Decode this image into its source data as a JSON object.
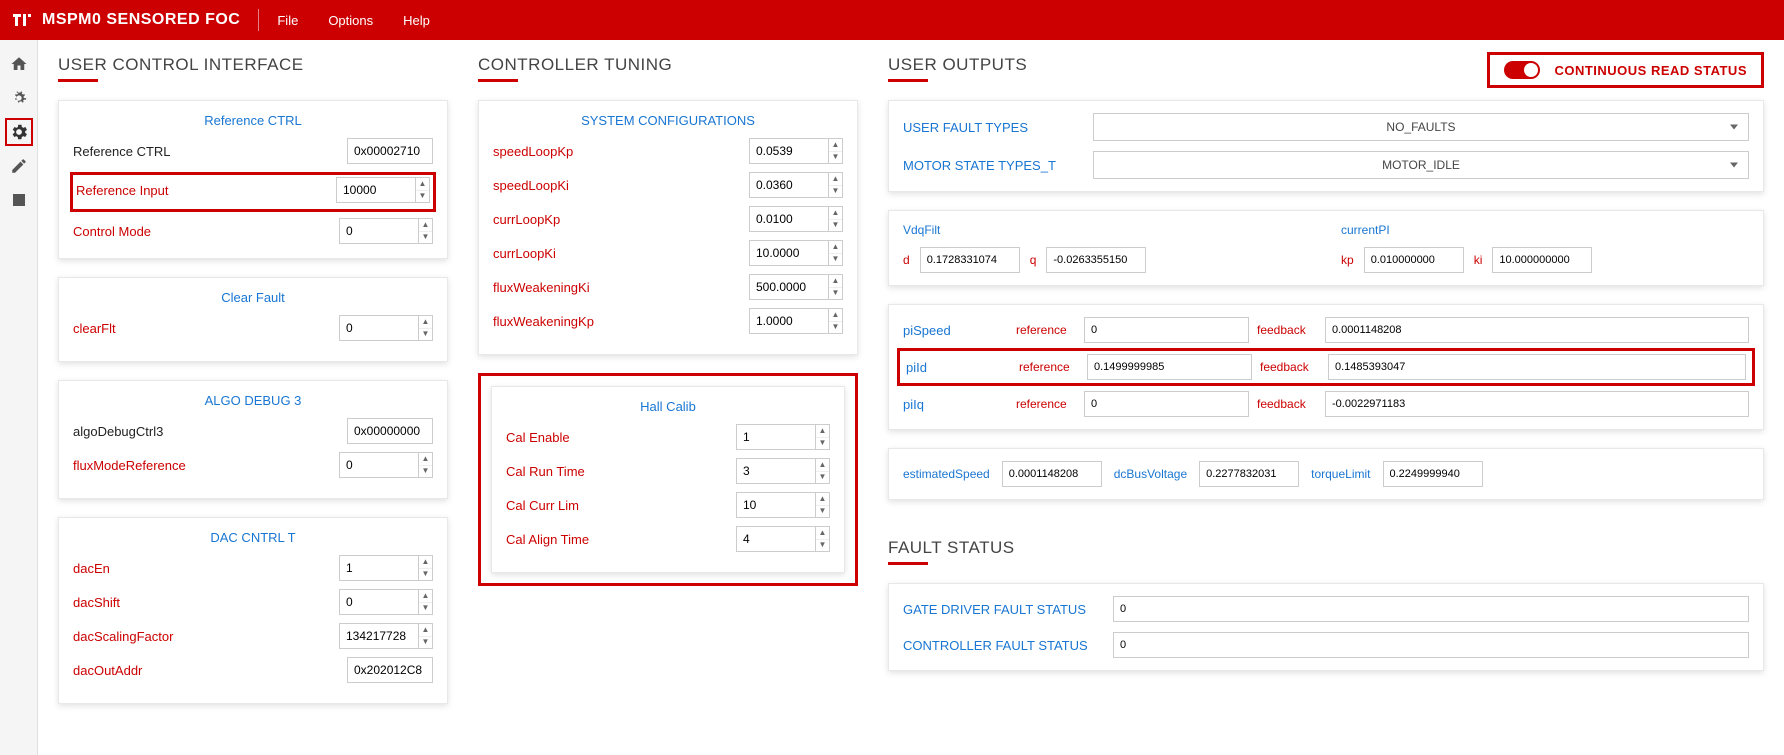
{
  "app": {
    "title": "MSPM0 SENSORED FOC"
  },
  "menu": {
    "file": "File",
    "options": "Options",
    "help": "Help"
  },
  "readStatus": "CONTINUOUS READ STATUS",
  "sections": {
    "userControl": "USER CONTROL INTERFACE",
    "controllerTuning": "CONTROLLER TUNING",
    "userOutputs": "USER OUTPUTS",
    "faultStatus": "FAULT STATUS"
  },
  "refCtrl": {
    "title": "Reference CTRL",
    "rows": {
      "referenceCtrl": {
        "label": "Reference CTRL",
        "value": "0x00002710"
      },
      "referenceInput": {
        "label": "Reference Input",
        "value": "10000"
      },
      "controlMode": {
        "label": "Control Mode",
        "value": "0"
      }
    }
  },
  "clearFault": {
    "title": "Clear Fault",
    "clearFlt": {
      "label": "clearFlt",
      "value": "0"
    }
  },
  "algoDebug": {
    "title": "ALGO DEBUG 3",
    "algoDebugCtrl3": {
      "label": "algoDebugCtrl3",
      "value": "0x00000000"
    },
    "fluxModeReference": {
      "label": "fluxModeReference",
      "value": "0"
    }
  },
  "dacCntrl": {
    "title": "DAC CNTRL T",
    "dacEn": {
      "label": "dacEn",
      "value": "1"
    },
    "dacShift": {
      "label": "dacShift",
      "value": "0"
    },
    "dacScalingFactor": {
      "label": "dacScalingFactor",
      "value": "134217728"
    },
    "dacOutAddr": {
      "label": "dacOutAddr",
      "value": "0x202012C8"
    }
  },
  "sysConfig": {
    "title": "SYSTEM CONFIGURATIONS",
    "speedLoopKp": {
      "label": "speedLoopKp",
      "value": "0.0539"
    },
    "speedLoopKi": {
      "label": "speedLoopKi",
      "value": "0.0360"
    },
    "currLoopKp": {
      "label": "currLoopKp",
      "value": "0.0100"
    },
    "currLoopKi": {
      "label": "currLoopKi",
      "value": "10.0000"
    },
    "fluxWeakeningKi": {
      "label": "fluxWeakeningKi",
      "value": "500.0000"
    },
    "fluxWeakeningKp": {
      "label": "fluxWeakeningKp",
      "value": "1.0000"
    }
  },
  "hallCalib": {
    "title": "Hall Calib",
    "calEnable": {
      "label": "Cal Enable",
      "value": "1"
    },
    "calRunTime": {
      "label": "Cal Run Time",
      "value": "3"
    },
    "calCurrLim": {
      "label": "Cal Curr Lim",
      "value": "10"
    },
    "calAlignTime": {
      "label": "Cal Align Time",
      "value": "4"
    }
  },
  "userOutputs": {
    "userFaultTypes": {
      "label": "USER FAULT TYPES",
      "value": "NO_FAULTS"
    },
    "motorStateTypes": {
      "label": "MOTOR STATE TYPES_T",
      "value": "MOTOR_IDLE"
    },
    "vdqFilt": {
      "title": "VdqFilt",
      "d": {
        "label": "d",
        "value": "0.1728331074"
      },
      "q": {
        "label": "q",
        "value": "-0.0263355150"
      }
    },
    "currentPI": {
      "title": "currentPI",
      "kp": {
        "label": "kp",
        "value": "0.010000000"
      },
      "ki": {
        "label": "ki",
        "value": "10.000000000"
      }
    },
    "piSpeed": {
      "name": "piSpeed",
      "refLabel": "reference",
      "ref": "0",
      "fbLabel": "feedback",
      "fb": "0.0001148208"
    },
    "piId": {
      "name": "piId",
      "refLabel": "reference",
      "ref": "0.1499999985",
      "fbLabel": "feedback",
      "fb": "0.1485393047"
    },
    "piIq": {
      "name": "piIq",
      "refLabel": "reference",
      "ref": "0",
      "fbLabel": "feedback",
      "fb": "-0.0022971183"
    },
    "estimatedSpeed": {
      "label": "estimatedSpeed",
      "value": "0.0001148208"
    },
    "dcBusVoltage": {
      "label": "dcBusVoltage",
      "value": "0.2277832031"
    },
    "torqueLimit": {
      "label": "torqueLimit",
      "value": "0.2249999940"
    }
  },
  "faultStatus": {
    "gateDriver": {
      "label": "GATE DRIVER FAULT STATUS",
      "value": "0"
    },
    "controller": {
      "label": "CONTROLLER FAULT STATUS",
      "value": "0"
    }
  }
}
